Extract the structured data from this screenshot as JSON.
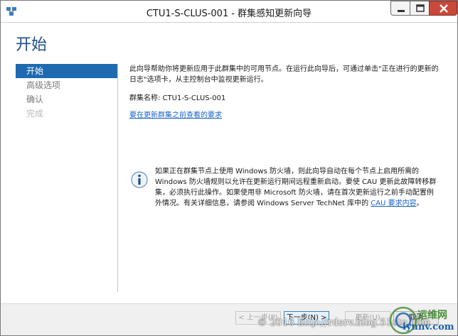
{
  "window": {
    "title": "CTU1-S-CLUS-001 - 群集感知更新向导"
  },
  "header": {
    "title": "开始"
  },
  "sidebar": {
    "items": [
      {
        "label": "开始",
        "state": "active"
      },
      {
        "label": "高级选项",
        "state": "normal"
      },
      {
        "label": "确认",
        "state": "normal"
      },
      {
        "label": "完成",
        "state": "disabled"
      }
    ]
  },
  "main": {
    "intro": "此向导帮助你将更新应用于此群集中的可用节点。在运行此向导后，可通过单击\"正在进行的更新的日志\"选项卡，从主控制台中监视更新运行。",
    "cluster_label": "群集名称: CTU1-S-CLUS-001",
    "requirements_link": "要在更新群集之前查看的要求"
  },
  "info": {
    "text": "如果正在群集节点上使用 Windows 防火墙，则此向导自动在每个节点上启用所需的 Windows 防火墙规则以允许在更新运行期间远程重新启动。要使 CAU 更新此故障转移群集，必须执行此操作。如果使用非 Microsoft 防火墙，请在首次更新运行之前手动配置例外情况。有关详细信息，请参阅 Windows Server TechNet 库中的 ",
    "link": "CAU 要求内容",
    "suffix": "。"
  },
  "footer": {
    "prev_label": "< 上一步(P)",
    "next_label": "下一步(N) >",
    "update_label": "更新(U)",
    "cancel_label": "取消"
  },
  "watermark": {
    "text": "© 2016 http://rdsrv.blog.51cto.com",
    "logo_cn": "运维网",
    "logo_site": "iyunv.com"
  },
  "colors": {
    "accent": "#1e6ab0",
    "title": "#1e4d8c",
    "link": "#1a64c8",
    "close": "#c9493b"
  }
}
